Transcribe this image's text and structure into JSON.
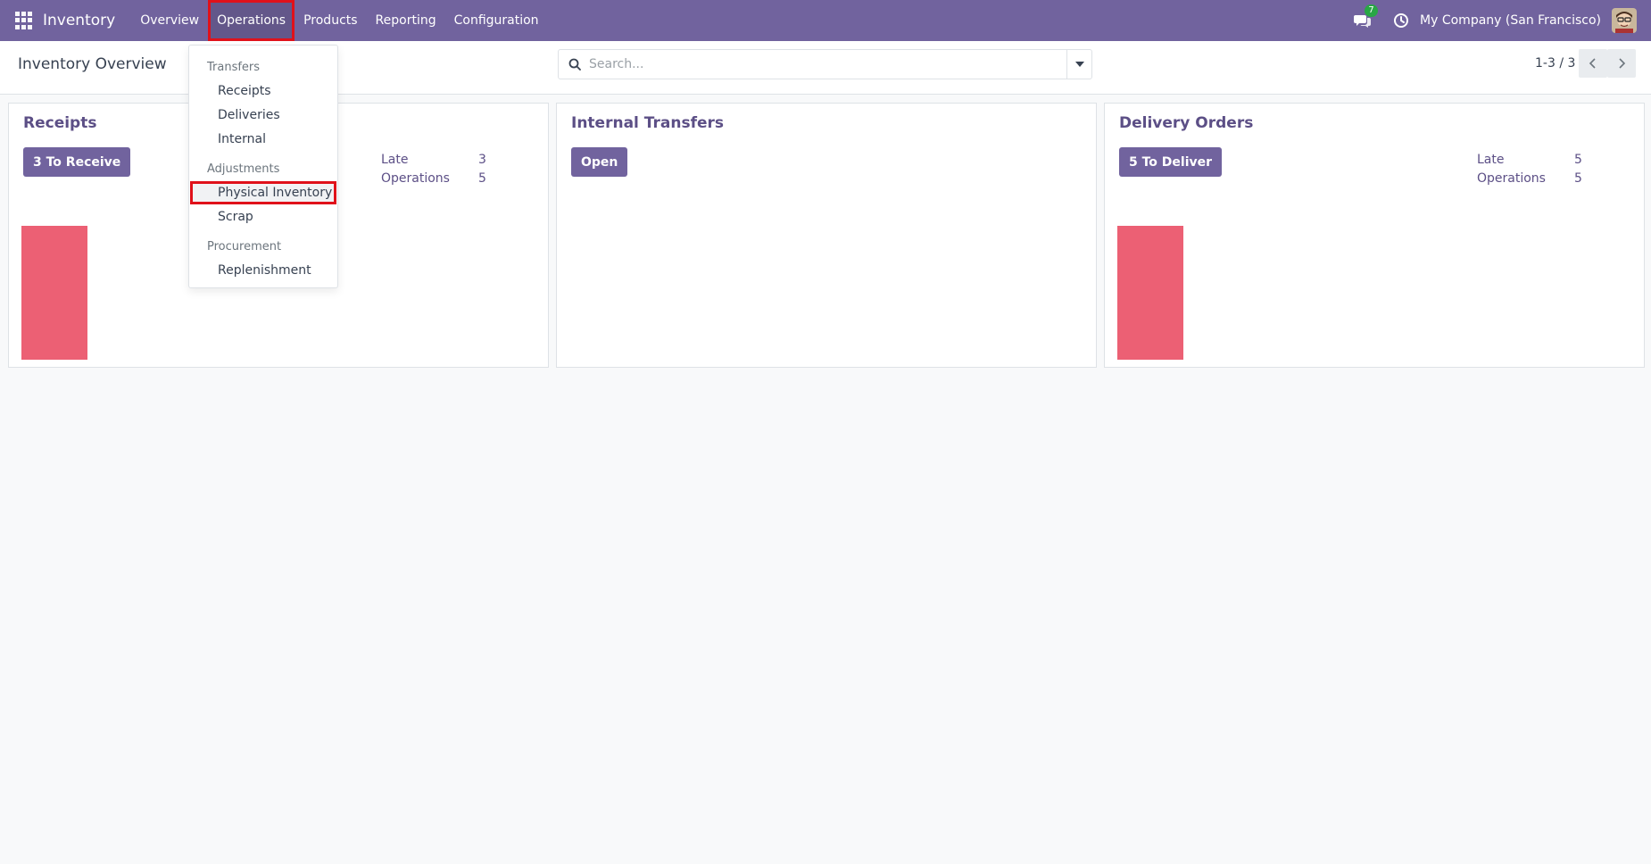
{
  "navbar": {
    "brand": "Inventory",
    "menu": [
      "Overview",
      "Operations",
      "Products",
      "Reporting",
      "Configuration"
    ],
    "active_menu": "Operations",
    "messages_count": "7",
    "company": "My Company (San Francisco)",
    "background_color": "#71639e"
  },
  "control_panel": {
    "title": "Inventory Overview",
    "search_placeholder": "Search...",
    "pager": "1-3 / 3"
  },
  "dropdown": {
    "sections": [
      {
        "header": "Transfers",
        "items": [
          "Receipts",
          "Deliveries",
          "Internal"
        ]
      },
      {
        "header": "Adjustments",
        "items": [
          "Physical Inventory",
          "Scrap"
        ]
      },
      {
        "header": "Procurement",
        "items": [
          "Replenishment"
        ]
      }
    ],
    "highlighted_item": "Physical Inventory"
  },
  "cards": [
    {
      "title": "Receipts",
      "button": "3 To Receive",
      "stats": [
        {
          "label": "Late",
          "value": "3"
        },
        {
          "label": "Operations",
          "value": "5"
        }
      ],
      "graph_bar_value": 1
    },
    {
      "title": "Internal Transfers",
      "button": "Open",
      "stats": [],
      "graph_bar_value": null
    },
    {
      "title": "Delivery Orders",
      "button": "5 To Deliver",
      "stats": [
        {
          "label": "Late",
          "value": "5"
        },
        {
          "label": "Operations",
          "value": "5"
        }
      ],
      "graph_bar_value": 1
    }
  ],
  "colors": {
    "accent": "#71639e",
    "card_title": "#5c4f86",
    "graph_bar": "#ec6074",
    "highlight_outline": "#e0111a"
  }
}
